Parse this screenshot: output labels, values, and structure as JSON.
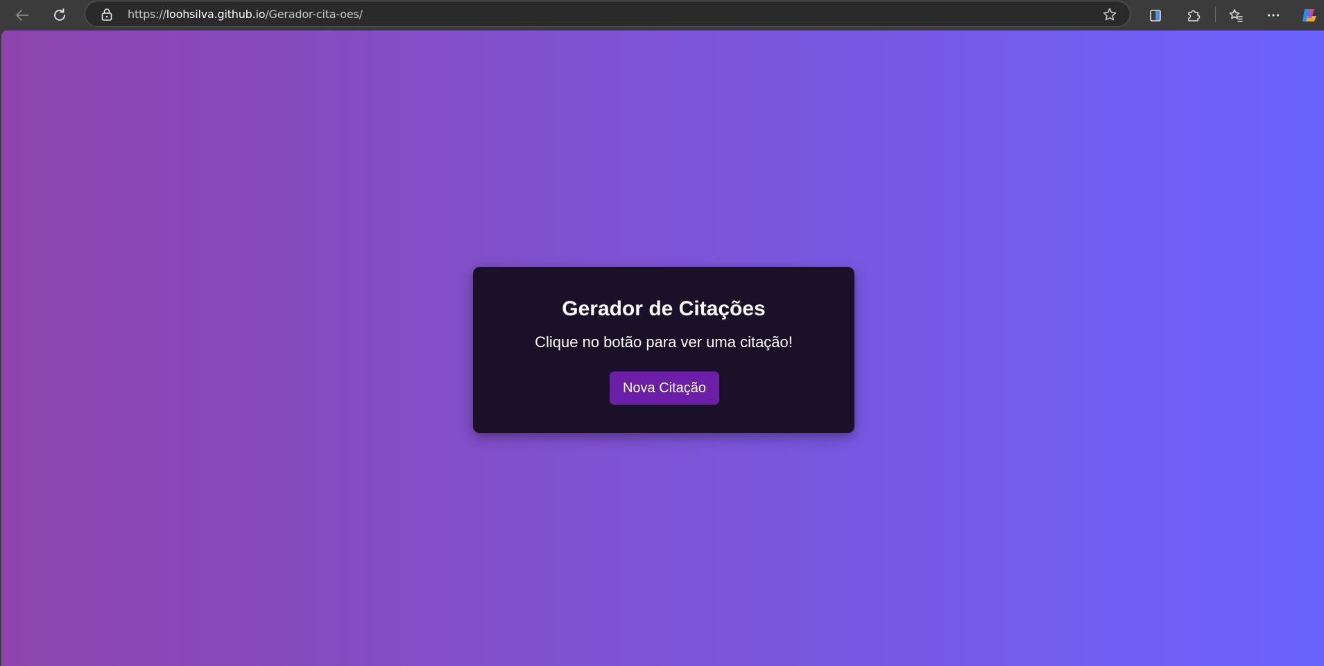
{
  "browser": {
    "url_scheme": "https://",
    "url_host": "loohsilva.github.io",
    "url_path": "/Gerador-cita-oes/",
    "icons": {
      "back": "back-arrow-icon",
      "reload": "reload-icon",
      "lock": "lock-icon",
      "favorite": "star-icon",
      "split_screen": "split-screen-icon",
      "extensions": "puzzle-icon",
      "favorites": "favorites-icon",
      "menu": "more-icon",
      "copilot": "copilot-icon"
    }
  },
  "page": {
    "background_gradient": [
      "#8e44ad",
      "#6c63ff"
    ],
    "card": {
      "title": "Gerador de Citações",
      "quote": "Clique no botão para ver uma citação!",
      "button_label": "Nova Citação",
      "background": "#1a1128",
      "button_color": "#6a1fa6"
    }
  }
}
